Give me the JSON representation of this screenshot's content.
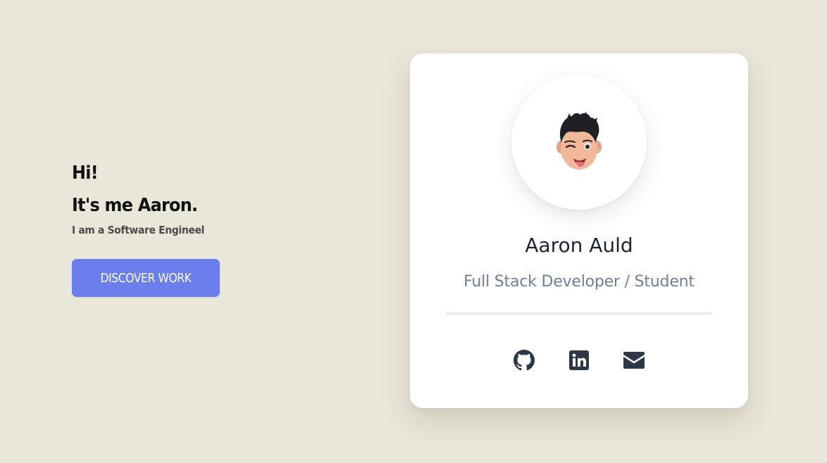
{
  "intro": {
    "greeting": "Hi!",
    "headline": "It's me Aaron.",
    "tagline": "I am a Software Engineel",
    "cta_label": "DISCOVER WORK"
  },
  "profile": {
    "avatar": "memoji-avatar",
    "name": "Aaron Auld",
    "role": "Full Stack Developer / Student",
    "social_links": [
      {
        "icon": "github-icon"
      },
      {
        "icon": "linkedin-icon"
      },
      {
        "icon": "email-icon"
      }
    ]
  },
  "colors": {
    "background": "#e9e6da",
    "accent": "#6a7fed",
    "card": "#ffffff",
    "icon": "#2d3748",
    "role_text": "#6f7f99"
  }
}
